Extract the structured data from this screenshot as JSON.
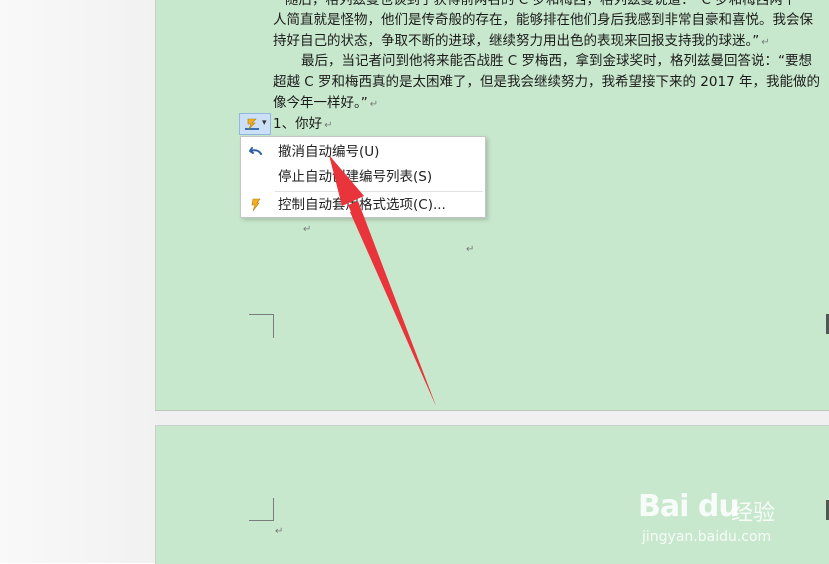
{
  "document": {
    "lines": [
      "随后，格列兹曼也谈到了获得前两名的 C 罗和梅西，格列兹曼说道：“C 罗和梅西两个",
      "人简直就是怪物，他们是传奇般的存在，能够排在他们身后我感到非常自豪和喜悦。我会保",
      "持好自己的状态，争取不断的进球，继续努力用出色的表现来回报支持我的球迷。”",
      "最后，当记者问到他将来能否战胜 C 罗梅西，拿到金球奖时，格列兹曼回答说：“要想",
      "超越 C 罗和梅西真的是太困难了，但是我会继续努力，我希望接下来的 2017 年，我能做的",
      "像今年一样好。”",
      "1、你好"
    ],
    "paragraph_mark": "↵"
  },
  "autocorrect_button": {
    "icon": "lightning-icon",
    "arrow": "▾"
  },
  "context_menu": {
    "items": [
      {
        "label": "撤消自动编号(U)",
        "icon": "undo-icon"
      },
      {
        "label": "停止自动创建编号列表(S)",
        "icon": ""
      },
      {
        "label": "控制自动套用格式选项(C)...",
        "icon": "lightning-icon"
      }
    ]
  },
  "watermark": {
    "logo": "Bai du",
    "chinese": "经验",
    "url": "jingyan.baidu.com"
  },
  "colors": {
    "page_background": "#c8e8cd",
    "annotation_arrow": "#e8343a"
  }
}
